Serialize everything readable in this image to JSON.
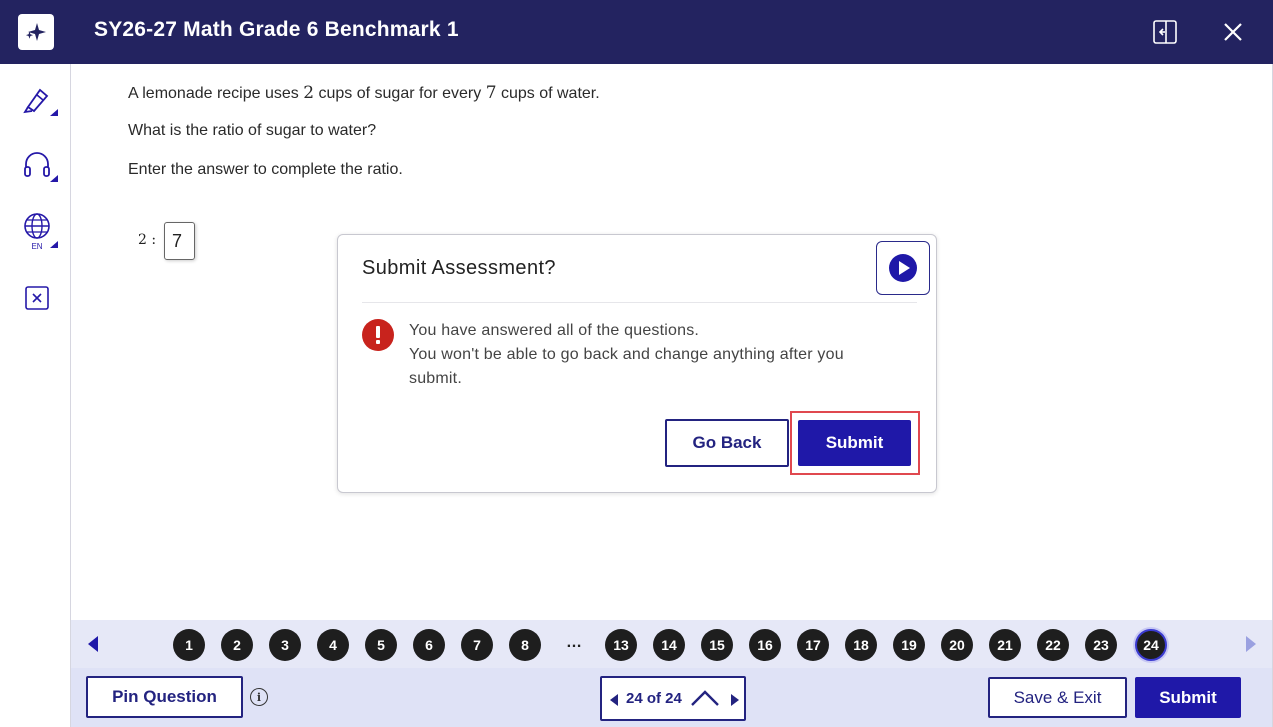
{
  "header": {
    "title": "SY26-27 Math Grade 6 Benchmark 1",
    "logo_icon": "sparkle-logo-icon",
    "collapse_icon": "collapse-panel-icon",
    "close_icon": "close-icon",
    "bg_color": "#232360"
  },
  "sidebar": {
    "tools": [
      {
        "name": "highlighter-tool",
        "icon": "highlighter-icon"
      },
      {
        "name": "audio-tool",
        "icon": "headphones-icon"
      },
      {
        "name": "language-tool",
        "icon": "globe-icon",
        "label": "EN"
      },
      {
        "name": "eliminator-tool",
        "icon": "answer-eliminator-icon"
      }
    ]
  },
  "question": {
    "line1_a": "A lemonade recipe uses ",
    "line1_num1": "2",
    "line1_b": " cups of sugar for every ",
    "line1_num2": "7",
    "line1_c": " cups of water.",
    "line2": "What is the ratio of sugar to water?",
    "line3": "Enter the answer to complete the ratio.",
    "ratio_prefix": "2 :",
    "answer_value": "7"
  },
  "modal": {
    "title": "Submit Assessment?",
    "play_icon": "play-icon",
    "warning_icon": "exclamation-icon",
    "message_line1": "You have answered all of the questions.",
    "message_line2": "You won't be able to go back and change anything after you submit.",
    "go_back_label": "Go Back",
    "submit_label": "Submit"
  },
  "navigator": {
    "items": [
      "1",
      "2",
      "3",
      "4",
      "5",
      "6",
      "7",
      "8",
      "…",
      "13",
      "14",
      "15",
      "16",
      "17",
      "18",
      "19",
      "20",
      "21",
      "22",
      "23",
      "24"
    ],
    "current": "24"
  },
  "footer": {
    "pin_label": "Pin Question",
    "info_icon": "info-icon",
    "pager_text": "24 of 24",
    "save_exit_label": "Save & Exit",
    "submit_label": "Submit"
  },
  "colors": {
    "accent": "#1f18a8",
    "highlight": "#e0484f",
    "warning": "#c8231d"
  }
}
